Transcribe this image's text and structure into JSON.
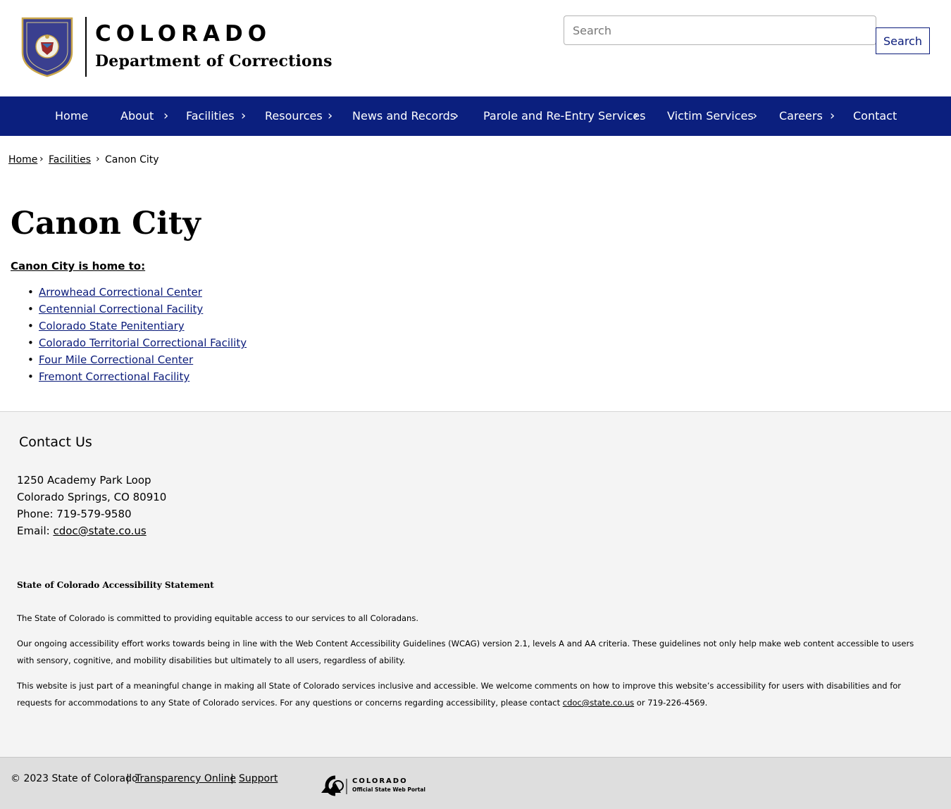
{
  "header": {
    "logo_state": "COLORADO",
    "logo_department": "Department of Corrections",
    "search": {
      "placeholder": "Search",
      "button_label": "Search"
    }
  },
  "nav": {
    "items": [
      {
        "label": "Home",
        "has_submenu": false
      },
      {
        "label": "About",
        "has_submenu": true
      },
      {
        "label": "Facilities",
        "has_submenu": true
      },
      {
        "label": "Resources",
        "has_submenu": true
      },
      {
        "label": "News and Records",
        "has_submenu": true
      },
      {
        "label": "Parole and Re-Entry Services",
        "has_submenu": true
      },
      {
        "label": "Victim Services",
        "has_submenu": true
      },
      {
        "label": "Careers",
        "has_submenu": true
      },
      {
        "label": "Contact",
        "has_submenu": false
      }
    ],
    "chevron": "›"
  },
  "breadcrumb": {
    "items": [
      "Home",
      "Facilities",
      "Canon City"
    ],
    "separator": "›"
  },
  "main": {
    "title": "Canon City",
    "intro": "Canon City is home to:",
    "facilities": [
      "Arrowhead Correctional Center",
      "Centennial Correctional Facility",
      "Colorado State Penitentiary",
      "Colorado Territorial Correctional Facility",
      "Four Mile Correctional Center",
      "Fremont Correctional Facility"
    ]
  },
  "contact": {
    "title": "Contact Us",
    "address_line1": "1250 Academy Park Loop",
    "address_line2": "Colorado Springs, CO 80910",
    "phone": "Phone: 719-579-9580",
    "email_label": "Email:",
    "email": "cdoc@state.co.us"
  },
  "accessibility": {
    "title": "State of Colorado Accessibility Statement",
    "p1": "The State of Colorado is committed to providing equitable access to our services to all Coloradans.",
    "p2": "Our ongoing accessibility effort works towards being in line with the Web Content Accessibility Guidelines (WCAG) version 2.1, levels A and AA criteria. These guidelines not only help make web content accessible to users with sensory, cognitive, and mobility disabilities but ultimately to all users, regardless of ability.",
    "p3_before": "This website is just part of a meaningful change in making all State of Colorado services inclusive and accessible. We welcome comments on how to improve this website’s accessibility for users with disabilities and for requests for accommodations to any State of Colorado services. For any questions or concerns regarding accessibility, please contact",
    "p3_email": "cdoc@state.co.us",
    "p3_after": "or 719-226-4569."
  },
  "footer": {
    "copyright": "© 2023 State of Colorado",
    "separator": "|",
    "links": [
      "Transparency Online",
      "Support"
    ],
    "portal_name": "COLORADO",
    "portal_sub": "Official State Web Portal"
  },
  "colors": {
    "nav_background": "#0b1f7e",
    "link_blue": "#0a1b7a",
    "contact_background": "#f4f4f4",
    "footer_background": "#dedede"
  }
}
